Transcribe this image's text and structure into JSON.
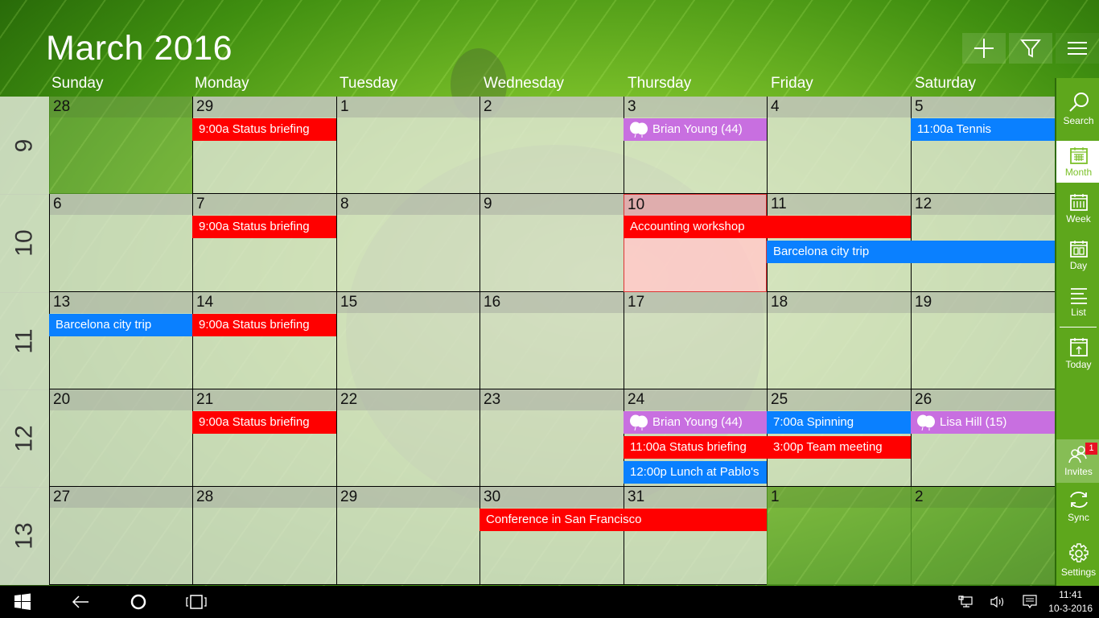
{
  "header": {
    "title": "March 2016",
    "add_label": "add",
    "filter_label": "filter",
    "menu_label": "menu"
  },
  "weekdays": [
    "Sunday",
    "Monday",
    "Tuesday",
    "Wednesday",
    "Thursday",
    "Friday",
    "Saturday"
  ],
  "weeks": [
    {
      "number": "9",
      "days": [
        "28",
        "29",
        "1",
        "2",
        "3",
        "4",
        "5"
      ]
    },
    {
      "number": "10",
      "days": [
        "6",
        "7",
        "8",
        "9",
        "10",
        "11",
        "12"
      ]
    },
    {
      "number": "11",
      "days": [
        "13",
        "14",
        "15",
        "16",
        "17",
        "18",
        "19"
      ]
    },
    {
      "number": "12",
      "days": [
        "20",
        "21",
        "22",
        "23",
        "24",
        "25",
        "26"
      ]
    },
    {
      "number": "13",
      "days": [
        "27",
        "28",
        "29",
        "30",
        "31",
        "1",
        "2"
      ]
    }
  ],
  "today": {
    "week": 1,
    "day": 4
  },
  "events": [
    {
      "week": 0,
      "day": 1,
      "span": 1,
      "slot": 0,
      "color": "red",
      "label": "9:00a Status briefing"
    },
    {
      "week": 0,
      "day": 4,
      "span": 1,
      "slot": 0,
      "color": "purple",
      "label": "Brian Young (44)",
      "icon": "balloon-icon"
    },
    {
      "week": 0,
      "day": 6,
      "span": 1,
      "slot": 0,
      "color": "blue",
      "label": "11:00a Tennis"
    },
    {
      "week": 1,
      "day": 1,
      "span": 1,
      "slot": 0,
      "color": "red",
      "label": "9:00a Status briefing"
    },
    {
      "week": 1,
      "day": 4,
      "span": 2,
      "slot": 0,
      "color": "red",
      "label": "Accounting workshop"
    },
    {
      "week": 1,
      "day": 5,
      "span": 2,
      "slot": 1,
      "color": "blue",
      "label": "Barcelona city trip"
    },
    {
      "week": 2,
      "day": 0,
      "span": 1,
      "slot": 0,
      "color": "blue",
      "label": "Barcelona city trip"
    },
    {
      "week": 2,
      "day": 1,
      "span": 1,
      "slot": 0,
      "color": "red",
      "label": "9:00a Status briefing"
    },
    {
      "week": 3,
      "day": 1,
      "span": 1,
      "slot": 0,
      "color": "red",
      "label": "9:00a Status briefing"
    },
    {
      "week": 3,
      "day": 4,
      "span": 1,
      "slot": 0,
      "color": "purple",
      "label": "Brian Young (44)",
      "icon": "balloon-icon"
    },
    {
      "week": 3,
      "day": 4,
      "span": 1,
      "slot": 1,
      "color": "red",
      "label": "11:00a Status briefing"
    },
    {
      "week": 3,
      "day": 4,
      "span": 1,
      "slot": 2,
      "color": "blue",
      "label": "12:00p Lunch at Pablo's"
    },
    {
      "week": 3,
      "day": 5,
      "span": 1,
      "slot": 0,
      "color": "blue",
      "label": "7:00a Spinning"
    },
    {
      "week": 3,
      "day": 5,
      "span": 1,
      "slot": 1,
      "color": "red",
      "label": "3:00p Team meeting"
    },
    {
      "week": 3,
      "day": 6,
      "span": 1,
      "slot": 0,
      "color": "purple",
      "label": "Lisa Hill (15)",
      "icon": "balloon-icon"
    },
    {
      "week": 4,
      "day": 3,
      "span": 2,
      "slot": 0,
      "color": "red",
      "label": "Conference in San Francisco"
    }
  ],
  "sidebar": {
    "search": "Search",
    "month": "Month",
    "week": "Week",
    "day": "Day",
    "list": "List",
    "today": "Today",
    "invites": "Invites",
    "invites_badge": "1",
    "sync": "Sync",
    "settings": "Settings"
  },
  "taskbar": {
    "time": "11:41",
    "date": "10-3-2016"
  },
  "colors": {
    "red": "#ff0000",
    "blue": "#0a80ff",
    "purple": "#c86fe0",
    "accent": "#5ea71c"
  }
}
